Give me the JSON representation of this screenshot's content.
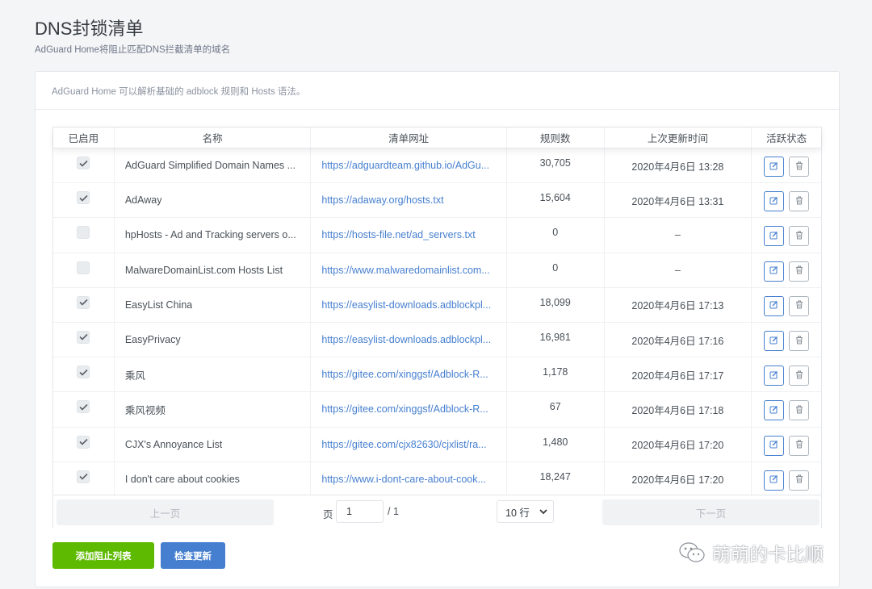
{
  "header": {
    "title": "DNS封锁清单",
    "subtitle": "AdGuard Home将阻止匹配DNS拦截清单的域名"
  },
  "card": {
    "description": "AdGuard Home 可以解析基础的 adblock 规则和 Hosts 语法。"
  },
  "table": {
    "columns": [
      "已启用",
      "名称",
      "清单网址",
      "规则数",
      "上次更新时间",
      "活跃状态"
    ],
    "rows": [
      {
        "enabled": true,
        "name": "AdGuard Simplified Domain Names ...",
        "url": "https://adguardteam.github.io/AdGu...",
        "rules": "30,705",
        "updated": "2020年4月6日 13:28"
      },
      {
        "enabled": true,
        "name": "AdAway",
        "url": "https://adaway.org/hosts.txt",
        "rules": "15,604",
        "updated": "2020年4月6日 13:31"
      },
      {
        "enabled": false,
        "name": "hpHosts - Ad and Tracking servers o...",
        "url": "https://hosts-file.net/ad_servers.txt",
        "rules": "0",
        "updated": "–"
      },
      {
        "enabled": false,
        "name": "MalwareDomainList.com Hosts List",
        "url": "https://www.malwaredomainlist.com...",
        "rules": "0",
        "updated": "–"
      },
      {
        "enabled": true,
        "name": "EasyList China",
        "url": "https://easylist-downloads.adblockpl...",
        "rules": "18,099",
        "updated": "2020年4月6日 17:13"
      },
      {
        "enabled": true,
        "name": "EasyPrivacy",
        "url": "https://easylist-downloads.adblockpl...",
        "rules": "16,981",
        "updated": "2020年4月6日 17:16"
      },
      {
        "enabled": true,
        "name": "乘风",
        "url": "https://gitee.com/xinggsf/Adblock-R...",
        "rules": "1,178",
        "updated": "2020年4月6日 17:17"
      },
      {
        "enabled": true,
        "name": "乘风视频",
        "url": "https://gitee.com/xinggsf/Adblock-R...",
        "rules": "67",
        "updated": "2020年4月6日 17:18"
      },
      {
        "enabled": true,
        "name": "CJX's Annoyance List",
        "url": "https://gitee.com/cjx82630/cjxlist/ra...",
        "rules": "1,480",
        "updated": "2020年4月6日 17:20"
      },
      {
        "enabled": true,
        "name": "I don't care about cookies",
        "url": "https://www.i-dont-care-about-cook...",
        "rules": "18,247",
        "updated": "2020年4月6日 17:20"
      }
    ]
  },
  "pagination": {
    "prev_label": "上一页",
    "next_label": "下一页",
    "page_label": "页",
    "page_value": "1",
    "total_label": "/ 1",
    "page_size": "10 行"
  },
  "actions": {
    "add_label": "添加阻止列表",
    "check_label": "检查更新"
  },
  "watermark": {
    "text": "萌萌的卡比顺"
  }
}
